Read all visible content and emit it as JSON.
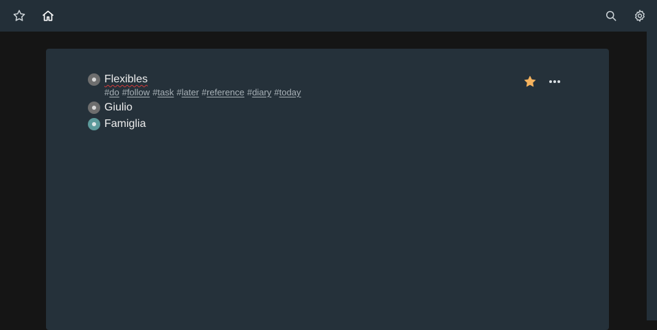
{
  "topbar": {
    "left_icons": [
      "star-outline-icon",
      "home-icon"
    ],
    "right_icons": [
      "search-icon",
      "gear-icon"
    ]
  },
  "list": {
    "items": [
      {
        "title": "Flexibles",
        "tags": [
          {
            "hash": "#",
            "word": "do"
          },
          {
            "hash": "#",
            "word": "follow"
          },
          {
            "hash": "#",
            "word": "task"
          },
          {
            "hash": "#",
            "word": "later"
          },
          {
            "hash": "#",
            "word": "reference"
          },
          {
            "hash": "#",
            "word": "diary"
          },
          {
            "hash": "#",
            "word": "today"
          }
        ],
        "bullet_color": "#6e6e6e"
      },
      {
        "title": "Giulio",
        "bullet_color": "#6e6e6e"
      },
      {
        "title": "Famiglia",
        "bullet_color": "#5c9a9b"
      }
    ]
  },
  "actions": {
    "star_color": "#f6b35e",
    "icons": [
      "star-filled-icon",
      "more-dots-icon"
    ]
  },
  "colors": {
    "topbar": "#232f38",
    "panel": "#25313a",
    "background": "#151515"
  }
}
